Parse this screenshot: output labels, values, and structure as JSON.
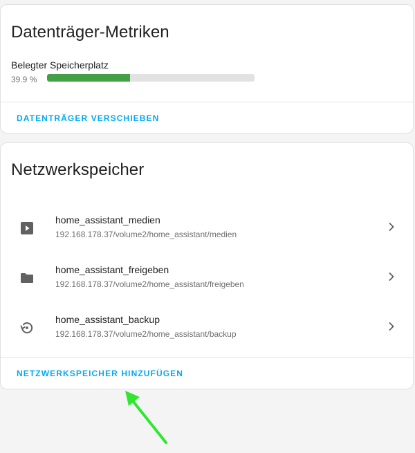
{
  "disk_metrics": {
    "title": "Datenträger-Metriken",
    "usage_label": "Belegter Speicherplatz",
    "usage_percent_text": "39.9 %",
    "usage_fraction": 0.399,
    "move_button_label": "DATENTRÄGER VERSCHIEBEN"
  },
  "network_storage": {
    "title": "Netzwerkspeicher",
    "items": [
      {
        "name": "home_assistant_medien",
        "path": "192.168.178.37/volume2/home_assistant/medien",
        "icon": "play-box-icon"
      },
      {
        "name": "home_assistant_freigeben",
        "path": "192.168.178.37/volume2/home_assistant/freigeben",
        "icon": "folder-icon"
      },
      {
        "name": "home_assistant_backup",
        "path": "192.168.178.37/volume2/home_assistant/backup",
        "icon": "backup-restore-icon"
      }
    ],
    "add_button_label": "NETZWERKSPEICHER HINZUFÜGEN"
  },
  "colors": {
    "accent": "#03a9f4",
    "progress": "#43a047",
    "annotation_arrow": "#2ee82e"
  }
}
